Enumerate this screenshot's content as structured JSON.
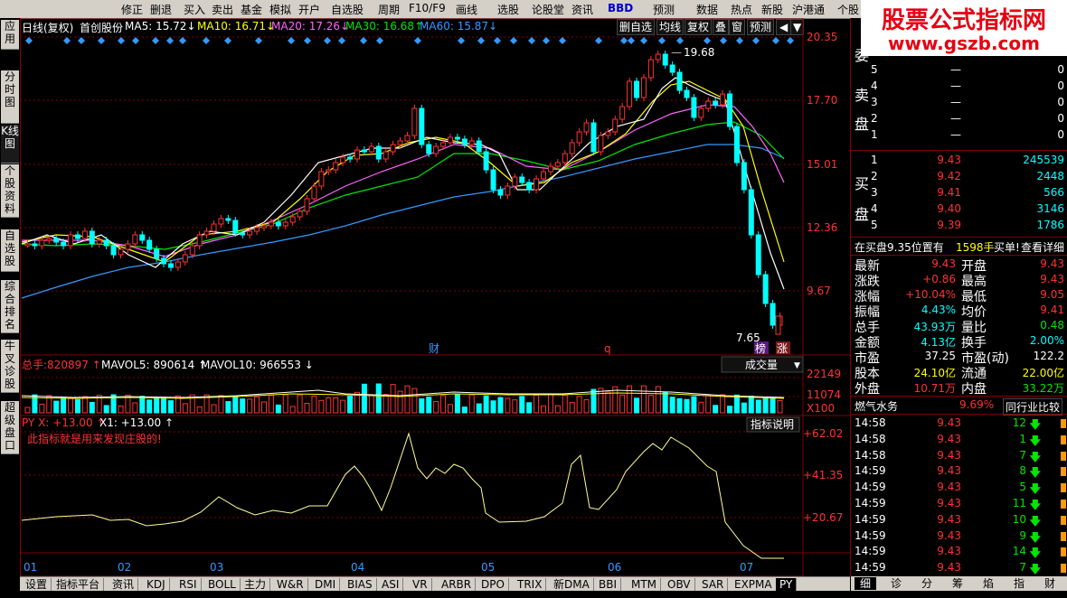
{
  "menu": [
    "修正",
    "删退",
    "买入",
    "卖出",
    "基金",
    "模拟",
    "开户",
    "自选股",
    "周期",
    "F10/F9",
    "画线",
    "选股",
    "论股堂",
    "资讯",
    "BBD",
    "预测",
    "数据",
    "热点",
    "新股",
    "沪港通",
    "个股"
  ],
  "watermark": {
    "title": "股票公式指标网",
    "url": "www.gszb.com"
  },
  "left_nav": [
    "应用",
    "分时图",
    "K线图",
    "个股资料",
    "自选股",
    "综合排名",
    "牛叉诊股",
    "超级盘口"
  ],
  "chart_header": {
    "period": "日线(复权)",
    "stock": "首创股份",
    "ma5_label": "MA5:",
    "ma5": "15.72",
    "ma10_label": "MA10:",
    "ma10": "16.71",
    "ma20_label": "MA20:",
    "ma20": "17.26",
    "ma30_label": "MA30:",
    "ma30": "16.68",
    "ma60_label": "MA60:",
    "ma60": "15.87",
    "buttons": [
      "删自选",
      "均线",
      "复权",
      "叠",
      "窗",
      "预测"
    ],
    "colors": {
      "ma5": "#ffffff",
      "ma10": "#ffff00",
      "ma20": "#ff66ff",
      "ma30": "#00e600",
      "ma60": "#3399ff"
    }
  },
  "price_axis": [
    "20.35",
    "17.70",
    "15.01",
    "12.36",
    "9.67"
  ],
  "price_marks": {
    "high": "19.68",
    "low": "7.65",
    "tag_bang": "榜",
    "tag_zhang": "涨",
    "tag_cai": "财",
    "tag_q": "q"
  },
  "volume_header": {
    "total_label": "总手:",
    "total": "820897",
    "mavol5_label": "MAVOL5:",
    "mavol5": "890614",
    "mavol10_label": "MAVOL10:",
    "mavol10": "966553",
    "dropdown": "成交量"
  },
  "volume_axis": [
    "22149",
    "11074",
    "X100"
  ],
  "indicator_header": {
    "name": "PY",
    "x_label": "X:",
    "x": "+13.00",
    "x1_label": "X1:",
    "x1": "+13.00",
    "explain_button": "指标说明",
    "note": "此指标就是用来发现庄股的!"
  },
  "indicator_axis": [
    "+62.02",
    "+41.35",
    "+20.67"
  ],
  "x_axis": [
    "01",
    "02",
    "03",
    "04",
    "05",
    "06",
    "07"
  ],
  "bottom_tabs": [
    "设置",
    "指标平台",
    "资讯",
    "KDJ",
    "RSI",
    "BOLL",
    "主力",
    "W&R",
    "DMI",
    "BIAS",
    "ASI",
    "VR",
    "ARBR",
    "DPO",
    "TRIX",
    "新DMA",
    "BBI",
    "MTM",
    "OBV",
    "SAR",
    "EXPMA",
    "PY"
  ],
  "order_book": {
    "sell_label_1": "卖",
    "sell_label_2": "盘",
    "buy_label_1": "买",
    "buy_label_2": "盘",
    "weibi_label": "委",
    "sell": [
      {
        "level": "5",
        "price": "—",
        "vol": "0"
      },
      {
        "level": "4",
        "price": "—",
        "vol": "0"
      },
      {
        "level": "3",
        "price": "—",
        "vol": "0"
      },
      {
        "level": "2",
        "price": "—",
        "vol": "0"
      },
      {
        "level": "1",
        "price": "—",
        "vol": "0"
      }
    ],
    "buy": [
      {
        "level": "1",
        "price": "9.43",
        "vol": "245539"
      },
      {
        "level": "2",
        "price": "9.42",
        "vol": "2448"
      },
      {
        "level": "3",
        "price": "9.41",
        "vol": "566"
      },
      {
        "level": "4",
        "price": "9.40",
        "vol": "3146"
      },
      {
        "level": "5",
        "price": "9.39",
        "vol": "1786"
      }
    ],
    "note_prefix": "在买盘9.35位置有",
    "note_vol": "1598手",
    "note_suffix": "买单!",
    "note_link": "查看详细"
  },
  "quote": [
    {
      "l1": "最新",
      "v1": "9.43",
      "c1": "red",
      "l2": "开盘",
      "v2": "9.43",
      "c2": "red"
    },
    {
      "l1": "涨跌",
      "v1": "+0.86",
      "c1": "red",
      "l2": "最高",
      "v2": "9.43",
      "c2": "red"
    },
    {
      "l1": "涨幅",
      "v1": "+10.04%",
      "c1": "red",
      "l2": "最低",
      "v2": "9.05",
      "c2": "red"
    },
    {
      "l1": "振幅",
      "v1": "4.43%",
      "c1": "cyn",
      "l2": "均价",
      "v2": "9.41",
      "c2": "red"
    },
    {
      "l1": "总手",
      "v1": "43.93万",
      "c1": "cyn",
      "l2": "量比",
      "v2": "0.48",
      "c2": "grn"
    },
    {
      "l1": "金额",
      "v1": "4.13亿",
      "c1": "cyn",
      "l2": "换手",
      "v2": "2.00%",
      "c2": "cyn"
    },
    {
      "l1": "市盈",
      "v1": "37.25",
      "c1": "wht",
      "l2": "市盈(动)",
      "v2": "122.2",
      "c2": "wht"
    },
    {
      "l1": "股本",
      "v1": "24.10亿",
      "c1": "yel",
      "l2": "流通",
      "v2": "22.00亿",
      "c2": "yel"
    },
    {
      "l1": "外盘",
      "v1": "10.71万",
      "c1": "red",
      "l2": "内盘",
      "v2": "33.22万",
      "c2": "grn"
    }
  ],
  "sector": {
    "name": "燃气水务",
    "pct": "9.69%",
    "compare": "同行业比较"
  },
  "ticks": [
    {
      "time": "14:58",
      "price": "9.43",
      "vol": "12"
    },
    {
      "time": "14:58",
      "price": "9.43",
      "vol": "1"
    },
    {
      "time": "14:58",
      "price": "9.43",
      "vol": "7"
    },
    {
      "time": "14:59",
      "price": "9.43",
      "vol": "8"
    },
    {
      "time": "14:59",
      "price": "9.43",
      "vol": "5"
    },
    {
      "time": "14:59",
      "price": "9.43",
      "vol": "11"
    },
    {
      "time": "14:59",
      "price": "9.43",
      "vol": "10"
    },
    {
      "time": "14:59",
      "price": "9.43",
      "vol": "9"
    },
    {
      "time": "14:59",
      "price": "9.43",
      "vol": "14"
    },
    {
      "time": "14:59",
      "price": "9.43",
      "vol": "7"
    }
  ],
  "right_tabs": [
    "细",
    "诊",
    "分",
    "筹",
    "焰",
    "指",
    "财"
  ]
}
